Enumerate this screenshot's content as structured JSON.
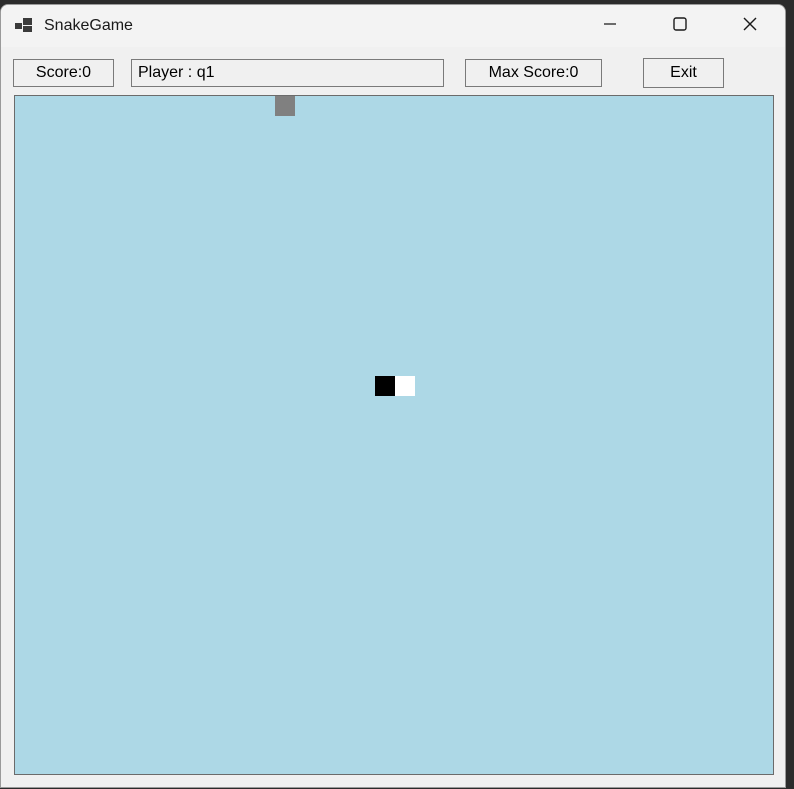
{
  "window": {
    "title": "SnakeGame"
  },
  "toolbar": {
    "score_label": "Score:0",
    "player_label": "Player : q1",
    "max_score_label": "Max Score:0",
    "exit_label": "Exit"
  },
  "colors": {
    "board_background": "#add8e6",
    "food": "#808080",
    "snake_head": "#000000",
    "snake_body": "#ffffff"
  },
  "icons": {
    "app": "app-window-icon",
    "minimize": "minimize-icon",
    "maximize": "maximize-icon",
    "close": "close-icon"
  }
}
